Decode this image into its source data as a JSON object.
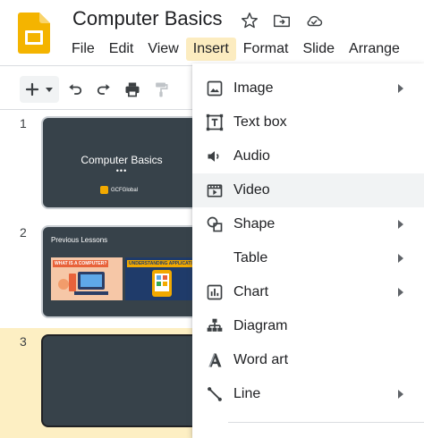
{
  "document": {
    "title": "Computer Basics"
  },
  "menubar": {
    "items": [
      {
        "label": "File"
      },
      {
        "label": "Edit"
      },
      {
        "label": "View"
      },
      {
        "label": "Insert"
      },
      {
        "label": "Format"
      },
      {
        "label": "Slide"
      },
      {
        "label": "Arrange"
      }
    ],
    "active": "Insert"
  },
  "slides": [
    {
      "number": "1",
      "title": "Computer Basics",
      "dots": "•••",
      "logo": "GCFGlobal"
    },
    {
      "number": "2",
      "title": "Previous Lessons",
      "thumb_a": "WHAT IS A COMPUTER?",
      "thumb_b": "UNDERSTANDING APPLICATIONS"
    },
    {
      "number": "3"
    }
  ],
  "insert_menu": {
    "items": [
      {
        "label": "Image",
        "icon": "image-icon",
        "submenu": true
      },
      {
        "label": "Text box",
        "icon": "text-box-icon",
        "submenu": false
      },
      {
        "label": "Audio",
        "icon": "audio-icon",
        "submenu": false
      },
      {
        "label": "Video",
        "icon": "video-icon",
        "submenu": false
      },
      {
        "label": "Shape",
        "icon": "shape-icon",
        "submenu": true
      },
      {
        "label": "Table",
        "icon": "",
        "submenu": true
      },
      {
        "label": "Chart",
        "icon": "chart-icon",
        "submenu": true
      },
      {
        "label": "Diagram",
        "icon": "diagram-icon",
        "submenu": false
      },
      {
        "label": "Word art",
        "icon": "word-art-icon",
        "submenu": false
      },
      {
        "label": "Line",
        "icon": "line-icon",
        "submenu": true
      }
    ],
    "hovered": "Video"
  },
  "colors": {
    "accent": "#fcecc0",
    "selected_slide_band": "#fdefc3",
    "slide_bg": "#37424a",
    "logo_yellow": "#f4b400"
  }
}
